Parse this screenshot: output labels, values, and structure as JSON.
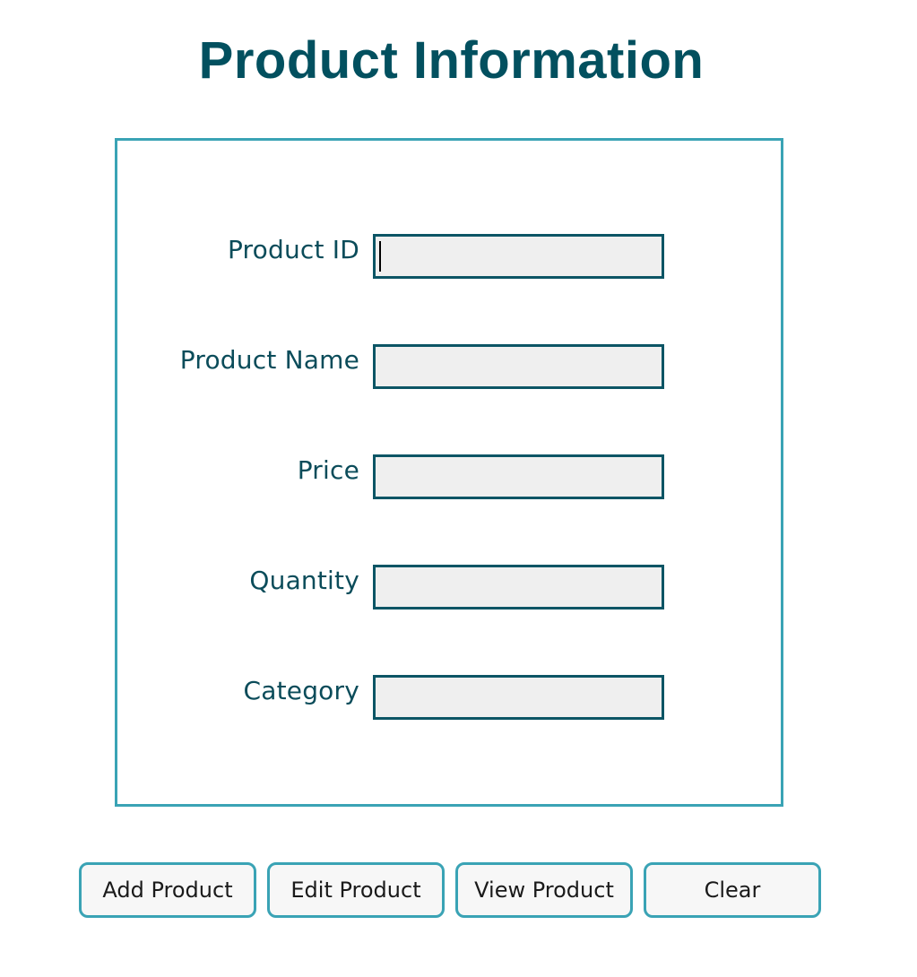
{
  "header": {
    "title": "Product Information"
  },
  "form": {
    "fields": [
      {
        "label": "Product ID",
        "value": "",
        "placeholder": ""
      },
      {
        "label": "Product Name",
        "value": "",
        "placeholder": ""
      },
      {
        "label": "Price",
        "value": "",
        "placeholder": ""
      },
      {
        "label": "Quantity",
        "value": "",
        "placeholder": ""
      },
      {
        "label": "Category",
        "value": "",
        "placeholder": ""
      }
    ]
  },
  "actions": {
    "add_label": "Add Product",
    "edit_label": "Edit Product",
    "view_label": "View Product",
    "clear_label": "Clear"
  },
  "colors": {
    "title": "#02505f",
    "panel_border": "#3aa3b5",
    "input_border": "#0c5565",
    "input_background": "#efefef",
    "label_text": "#0b4c5a"
  }
}
